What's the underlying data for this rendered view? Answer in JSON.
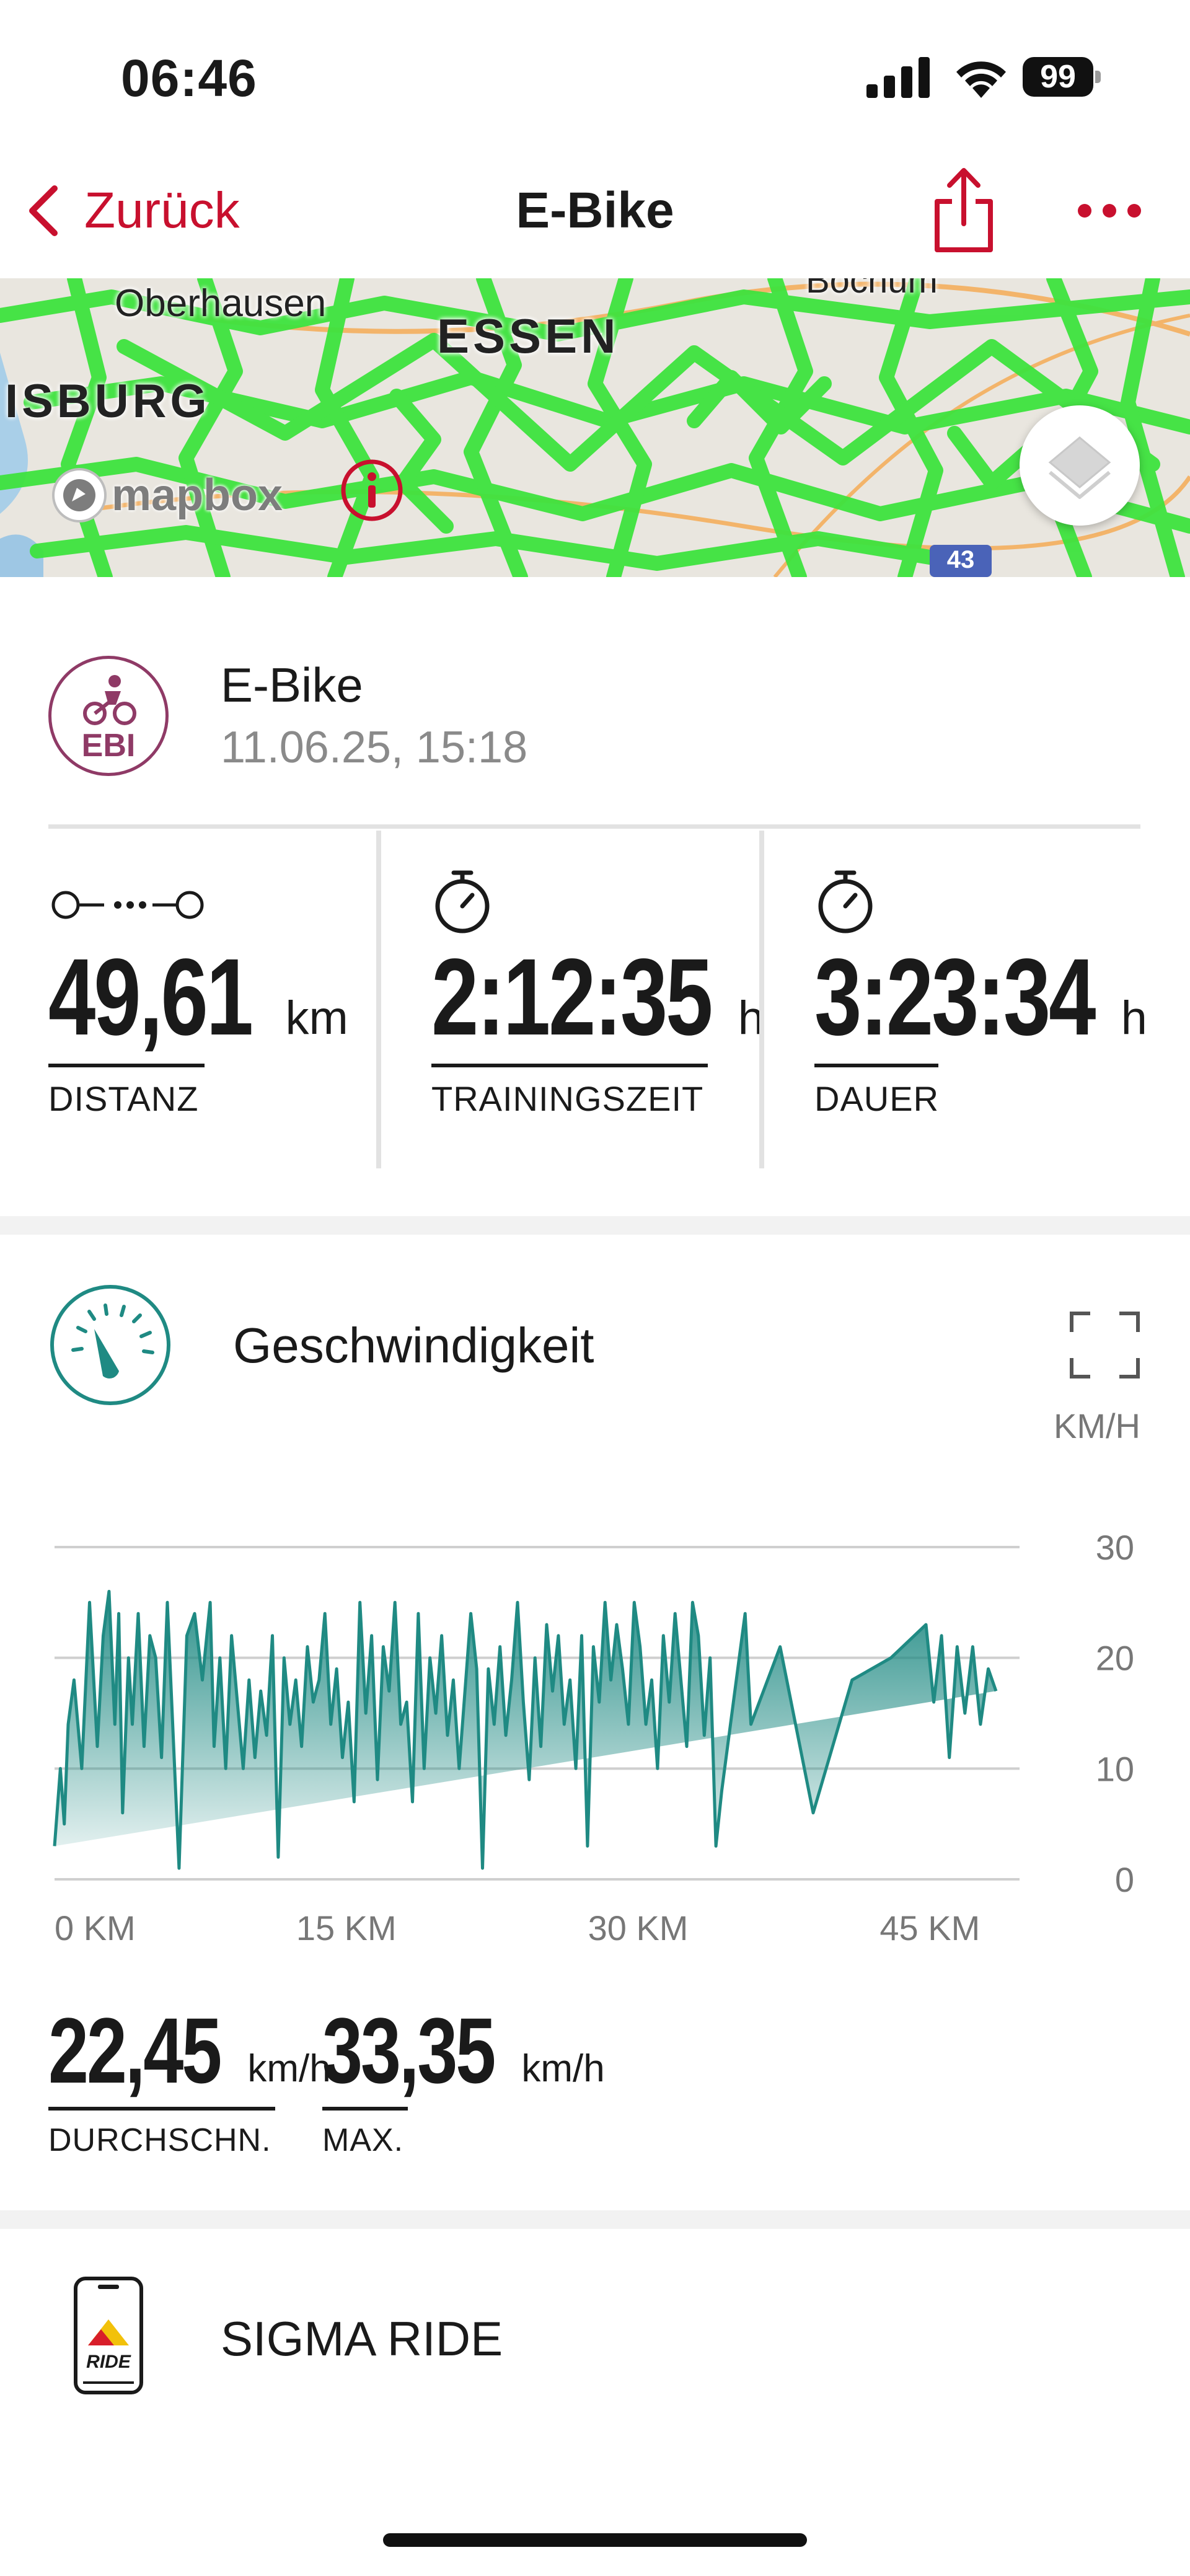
{
  "status_bar": {
    "time": "06:46",
    "battery": "99"
  },
  "nav": {
    "back_label": "Zurück",
    "title": "E-Bike"
  },
  "map": {
    "labels": [
      "Oberhausen",
      "ESSEN",
      "ISBURG",
      "Bochum"
    ],
    "attribution": "mapbox",
    "route_badge": "43"
  },
  "activity": {
    "badge": "EBI",
    "name": "E-Bike",
    "datetime": "11.06.25, 15:18"
  },
  "stats": [
    {
      "value": "49,61",
      "unit": "km",
      "label": "DISTANZ"
    },
    {
      "value": "2:12:35",
      "unit": "h",
      "label": "TRAININGSZEIT"
    },
    {
      "value": "3:23:34",
      "unit": "h",
      "label": "DAUER"
    }
  ],
  "speed": {
    "title": "Geschwindigkeit",
    "unit_label": "KM/H",
    "avg_value": "22,45",
    "avg_unit": "km/h",
    "avg_label": "DURCHSCHN.",
    "max_value": "33,35",
    "max_unit": "km/h",
    "max_label": "MAX."
  },
  "chart_data": {
    "type": "area",
    "xlabel": "",
    "ylabel": "",
    "x_ticks": [
      "0 KM",
      "15 KM",
      "30 KM",
      "45 KM"
    ],
    "y_ticks": [
      "30",
      "20",
      "10",
      "0"
    ],
    "ylim": [
      0,
      30
    ],
    "xlim": [
      0,
      49.61
    ],
    "color": "#1f8a83",
    "x": [
      0,
      0.3,
      0.5,
      0.7,
      1.0,
      1.4,
      1.8,
      2.2,
      2.5,
      2.8,
      3.1,
      3.3,
      3.5,
      3.8,
      4.0,
      4.3,
      4.6,
      4.9,
      5.2,
      5.5,
      5.8,
      6.1,
      6.4,
      6.8,
      7.2,
      7.6,
      8.0,
      8.2,
      8.5,
      8.8,
      9.1,
      9.4,
      9.7,
      10.0,
      10.3,
      10.6,
      10.9,
      11.2,
      11.5,
      11.8,
      12.1,
      12.4,
      12.7,
      13.0,
      13.3,
      13.6,
      13.9,
      14.2,
      14.5,
      14.8,
      15.1,
      15.4,
      15.7,
      16.0,
      16.3,
      16.6,
      16.9,
      17.2,
      17.5,
      17.8,
      18.1,
      18.4,
      18.7,
      19.0,
      19.3,
      19.6,
      19.9,
      20.2,
      20.5,
      20.8,
      21.1,
      21.4,
      21.7,
      22.0,
      22.3,
      22.6,
      22.9,
      23.2,
      23.5,
      23.8,
      24.1,
      24.4,
      24.7,
      25.0,
      25.3,
      25.6,
      25.9,
      26.2,
      26.5,
      26.8,
      27.1,
      27.4,
      27.7,
      28.0,
      28.3,
      28.6,
      28.9,
      29.2,
      29.5,
      29.8,
      30.1,
      30.4,
      30.7,
      31.0,
      31.3,
      31.6,
      31.9,
      32.2,
      32.5,
      32.8,
      33.1,
      33.4,
      33.7,
      34.0,
      34.3,
      34.6,
      34.9,
      35.2,
      35.5,
      35.8,
      37.3,
      39.0,
      41.0,
      43.0,
      44.8,
      45.2,
      45.6,
      46.0,
      46.4,
      46.8,
      47.2,
      47.6,
      48.0,
      48.4,
      48.8,
      49.2,
      49.61
    ],
    "y": [
      3,
      10,
      5,
      14,
      18,
      10,
      25,
      12,
      22,
      26,
      14,
      24,
      6,
      20,
      14,
      24,
      12,
      22,
      20,
      11,
      25,
      13,
      1,
      22,
      24,
      18,
      25,
      12,
      20,
      10,
      22,
      16,
      10,
      18,
      11,
      17,
      13,
      22,
      2,
      20,
      14,
      18,
      12,
      21,
      16,
      18,
      24,
      14,
      19,
      11,
      16,
      7,
      25,
      15,
      22,
      9,
      21,
      17,
      25,
      14,
      16,
      7,
      24,
      10,
      20,
      15,
      22,
      13,
      18,
      10,
      17,
      24,
      19,
      1,
      19,
      14,
      21,
      13,
      18,
      25,
      16,
      9,
      20,
      12,
      23,
      17,
      22,
      14,
      18,
      10,
      22,
      3,
      21,
      16,
      25,
      18,
      23,
      19,
      14,
      25,
      21,
      14,
      18,
      10,
      22,
      16,
      24,
      18,
      12,
      25,
      22,
      13,
      20,
      3,
      8,
      12,
      16,
      20,
      24,
      14,
      21,
      6,
      18,
      20,
      23,
      16,
      22,
      11,
      21,
      15,
      21,
      14,
      19,
      17
    ]
  },
  "source": {
    "name": "SIGMA RIDE",
    "app_icon_text": "RIDE"
  }
}
